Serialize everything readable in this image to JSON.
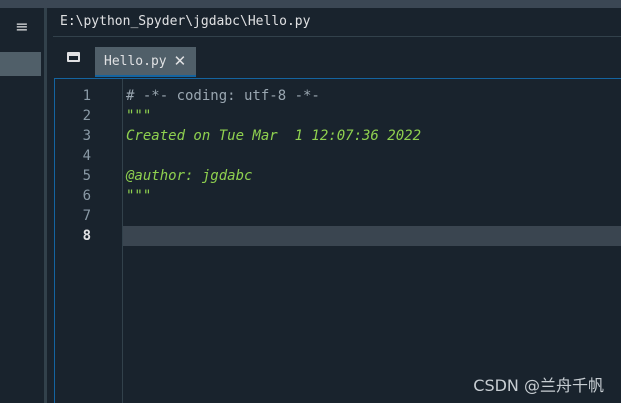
{
  "window": {
    "menu_glyph": "≡",
    "file_path": "E:\\python_Spyder\\jgdabc\\Hello.py"
  },
  "tabs": [
    {
      "label": "Hello.py",
      "close_glyph": "✕",
      "active": true
    }
  ],
  "editor": {
    "current_line": 8,
    "line_numbers": [
      "1",
      "2",
      "3",
      "4",
      "5",
      "6",
      "7",
      "8"
    ],
    "lines": [
      "# -*- coding: utf-8 -*-",
      "\"\"\"",
      "Created on Tue Mar  1 12:07:36 2022",
      "",
      "@author: jgdabc",
      "\"\"\"",
      "",
      ""
    ]
  },
  "watermark": "CSDN @兰舟千帆",
  "colors": {
    "background": "#19232d",
    "tab_active": "#505f69",
    "accent": "#1464a0",
    "comment": "#9aa7b1",
    "docstring": "#8fd14f",
    "current_line": "#3a4550"
  },
  "icons": {
    "menu": "hamburger-menu-icon",
    "browse_tabs": "window-icon",
    "tab_close": "close-icon"
  }
}
